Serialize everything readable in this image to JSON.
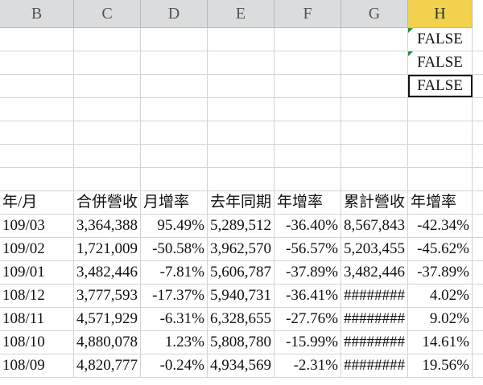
{
  "columns": [
    {
      "label": "B",
      "width": 92
    },
    {
      "label": "C",
      "width": 83
    },
    {
      "label": "D",
      "width": 83
    },
    {
      "label": "E",
      "width": 83
    },
    {
      "label": "F",
      "width": 83
    },
    {
      "label": "G",
      "width": 83
    },
    {
      "label": "H",
      "width": 80
    }
  ],
  "active_column": "H",
  "h_cells": [
    "FALSE",
    "FALSE",
    "FALSE"
  ],
  "headers": [
    "年/月",
    "合併營收",
    "月增率",
    "去年同期",
    "年增率",
    "累計營收",
    "年增率"
  ],
  "rows": [
    [
      "109/03",
      "3,364,388",
      "95.49%",
      "5,289,512",
      "-36.40%",
      "8,567,843",
      "-42.34%"
    ],
    [
      "109/02",
      "1,721,009",
      "-50.58%",
      "3,962,570",
      "-56.57%",
      "5,203,455",
      "-45.62%"
    ],
    [
      "109/01",
      "3,482,446",
      "-7.81%",
      "5,606,787",
      "-37.89%",
      "3,482,446",
      "-37.89%"
    ],
    [
      "108/12",
      "3,777,593",
      "-17.37%",
      "5,940,731",
      "-36.41%",
      "########",
      "4.02%"
    ],
    [
      "108/11",
      "4,571,929",
      "-6.31%",
      "6,328,655",
      "-27.76%",
      "########",
      "9.02%"
    ],
    [
      "108/10",
      "4,880,078",
      "1.23%",
      "5,808,780",
      "-15.99%",
      "########",
      "14.61%"
    ],
    [
      "108/09",
      "4,820,777",
      "-0.24%",
      "4,934,569",
      "-2.31%",
      "########",
      "19.56%"
    ]
  ]
}
